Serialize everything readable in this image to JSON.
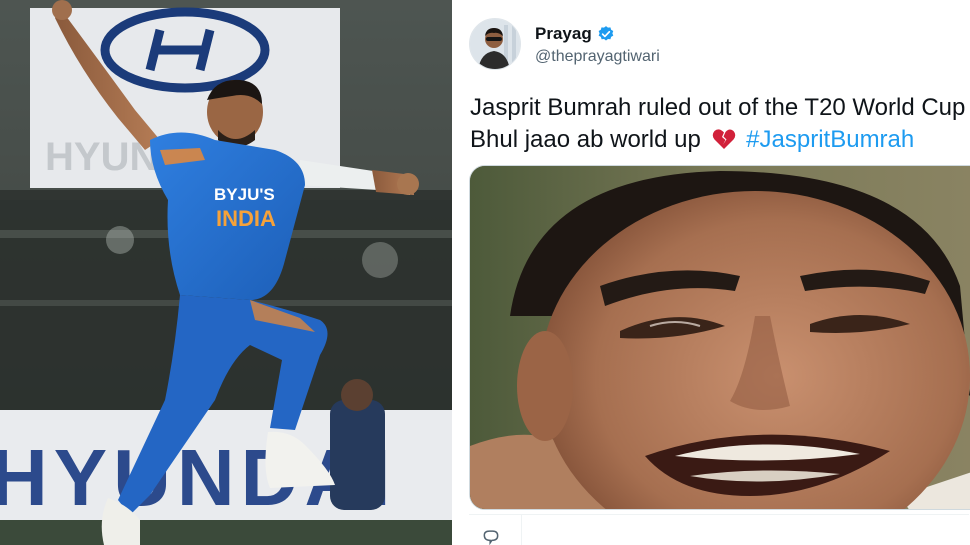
{
  "left_photo": {
    "banner_top": "HYUNDAI",
    "banner_bottom": "HYUNDAI",
    "jersey_sponsor": "BYJU'S",
    "jersey_team": "INDIA"
  },
  "tweet": {
    "author_name": "Prayag",
    "author_handle": "@theprayagtiwari",
    "text_line1": "Jasprit Bumrah ruled out of the T20 World Cup",
    "text_line2_prefix": "Bhul jaao ab world up",
    "hashtag": "#JaspritBumrah",
    "emoji": "broken-heart-icon",
    "media_description": "crying-man-meme",
    "colors": {
      "hashtag": "#1d9bf0",
      "verified": "#1d9bf0",
      "text": "#0f1419",
      "handle": "#536471",
      "broken_heart": "#d1213a"
    }
  }
}
